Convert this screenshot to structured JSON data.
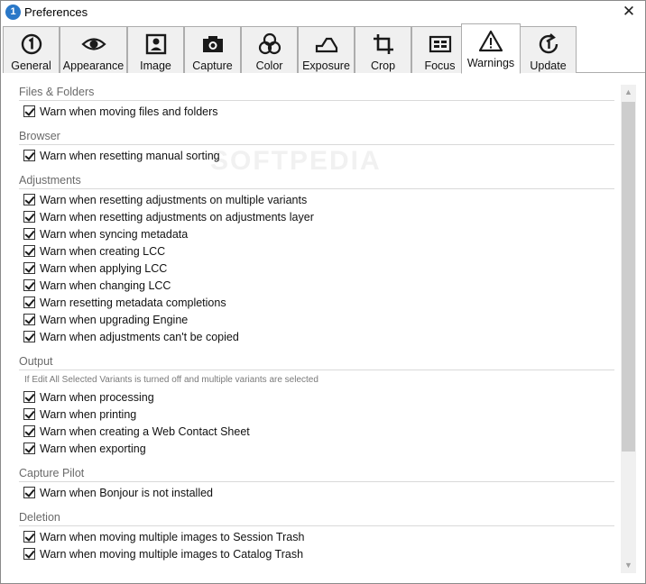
{
  "window": {
    "title": "Preferences",
    "close_symbol": "✕",
    "app_icon_text": "1"
  },
  "tabs": [
    {
      "label": "General",
      "icon": "general-icon"
    },
    {
      "label": "Appearance",
      "icon": "eye-icon"
    },
    {
      "label": "Image",
      "icon": "image-icon"
    },
    {
      "label": "Capture",
      "icon": "camera-icon"
    },
    {
      "label": "Color",
      "icon": "color-circles-icon"
    },
    {
      "label": "Exposure",
      "icon": "exposure-icon"
    },
    {
      "label": "Crop",
      "icon": "crop-icon"
    },
    {
      "label": "Focus",
      "icon": "focus-icon"
    },
    {
      "label": "Warnings",
      "icon": "warning-icon"
    },
    {
      "label": "Update",
      "icon": "update-icon"
    }
  ],
  "active_tab": "Warnings",
  "sections": {
    "files": {
      "title": "Files & Folders",
      "items": [
        "Warn when moving files and folders"
      ]
    },
    "browser": {
      "title": "Browser",
      "items": [
        "Warn when resetting manual sorting"
      ]
    },
    "adjustments": {
      "title": "Adjustments",
      "items": [
        "Warn when resetting adjustments on multiple variants",
        "Warn when resetting adjustments on adjustments layer",
        "Warn when syncing metadata",
        "Warn when creating LCC",
        "Warn when applying LCC",
        "Warn when changing LCC",
        "Warn resetting metadata completions",
        "Warn when upgrading Engine",
        "Warn when adjustments can't be copied"
      ]
    },
    "output": {
      "title": "Output",
      "note": "If Edit All Selected Variants is turned off and multiple variants are selected",
      "items": [
        "Warn when processing",
        "Warn when printing",
        "Warn when creating a Web Contact Sheet",
        "Warn when exporting"
      ]
    },
    "capture_pilot": {
      "title": "Capture Pilot",
      "items": [
        "Warn when Bonjour is not installed"
      ]
    },
    "deletion": {
      "title": "Deletion",
      "items": [
        "Warn when moving multiple images to Session Trash",
        "Warn when moving multiple images to Catalog Trash"
      ]
    }
  },
  "scroll": {
    "up_symbol": "▲",
    "down_symbol": "▼"
  },
  "watermark": "SOFTPEDIA"
}
